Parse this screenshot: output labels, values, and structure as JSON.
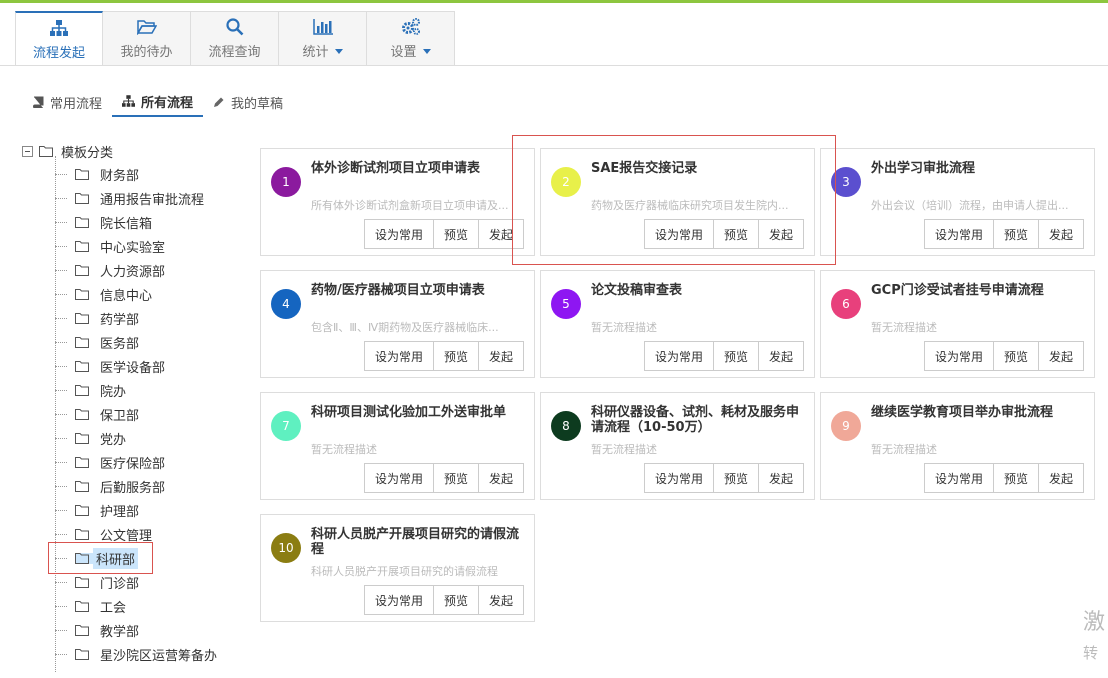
{
  "main_tabs": [
    {
      "label": "流程发起",
      "icon": "sitemap-icon",
      "active": true
    },
    {
      "label": "我的待办",
      "icon": "folder-open-icon"
    },
    {
      "label": "流程查询",
      "icon": "search-icon"
    },
    {
      "label": "统计",
      "icon": "bar-chart-icon",
      "dropdown": true
    },
    {
      "label": "设置",
      "icon": "gears-icon",
      "dropdown": true
    }
  ],
  "sub_tabs": [
    {
      "label": "常用流程",
      "icon": "book-icon"
    },
    {
      "label": "所有流程",
      "icon": "sitemap-icon",
      "active": true
    },
    {
      "label": "我的草稿",
      "icon": "pencil-icon"
    }
  ],
  "tree": {
    "root": "模板分类",
    "items": [
      "财务部",
      "通用报告审批流程",
      "院长信箱",
      "中心实验室",
      "人力资源部",
      "信息中心",
      "药学部",
      "医务部",
      "医学设备部",
      "院办",
      "保卫部",
      "党办",
      "医疗保险部",
      "后勤服务部",
      "护理部",
      "公文管理",
      "科研部",
      "门诊部",
      "工会",
      "教学部",
      "星沙院区运营筹备办"
    ],
    "selected": "科研部"
  },
  "card_buttons": {
    "favorite": "设为常用",
    "preview": "预览",
    "start": "发起"
  },
  "cards": [
    {
      "num": "1",
      "color": "#8b1a9e",
      "title": "体外诊断试剂项目立项申请表",
      "desc": "所有体外诊断试剂盒新项目立项申请及..."
    },
    {
      "num": "2",
      "color": "#e8f04a",
      "title": "SAE报告交接记录",
      "desc": "药物及医疗器械临床研究项目发生院内..."
    },
    {
      "num": "3",
      "color": "#5b4fcf",
      "title": "外出学习审批流程",
      "desc": "外出会议（培训）流程，由申请人提出..."
    },
    {
      "num": "4",
      "color": "#1565c0",
      "title": "药物/医疗器械项目立项申请表",
      "desc": "包含Ⅱ、Ⅲ、Ⅳ期药物及医疗器械临床..."
    },
    {
      "num": "5",
      "color": "#8e16f2",
      "title": "论文投稿审查表",
      "desc": "暂无流程描述"
    },
    {
      "num": "6",
      "color": "#e8407c",
      "title": "GCP门诊受试者挂号申请流程",
      "desc": "暂无流程描述"
    },
    {
      "num": "7",
      "color": "#5ff0c0",
      "title": "科研项目测试化验加工外送审批单",
      "desc": "暂无流程描述"
    },
    {
      "num": "8",
      "color": "#0d3b1f",
      "title": "科研仪器设备、试剂、耗材及服务申请流程（10-50万）",
      "desc": "暂无流程描述"
    },
    {
      "num": "9",
      "color": "#f0a898",
      "title": "继续医学教育项目举办审批流程",
      "desc": "暂无流程描述"
    },
    {
      "num": "10",
      "color": "#8b7d12",
      "title": "科研人员脱产开展项目研究的请假流程",
      "desc": "科研人员脱产开展项目研究的请假流程"
    }
  ],
  "watermark": {
    "line1": "激",
    "line2": "转"
  }
}
